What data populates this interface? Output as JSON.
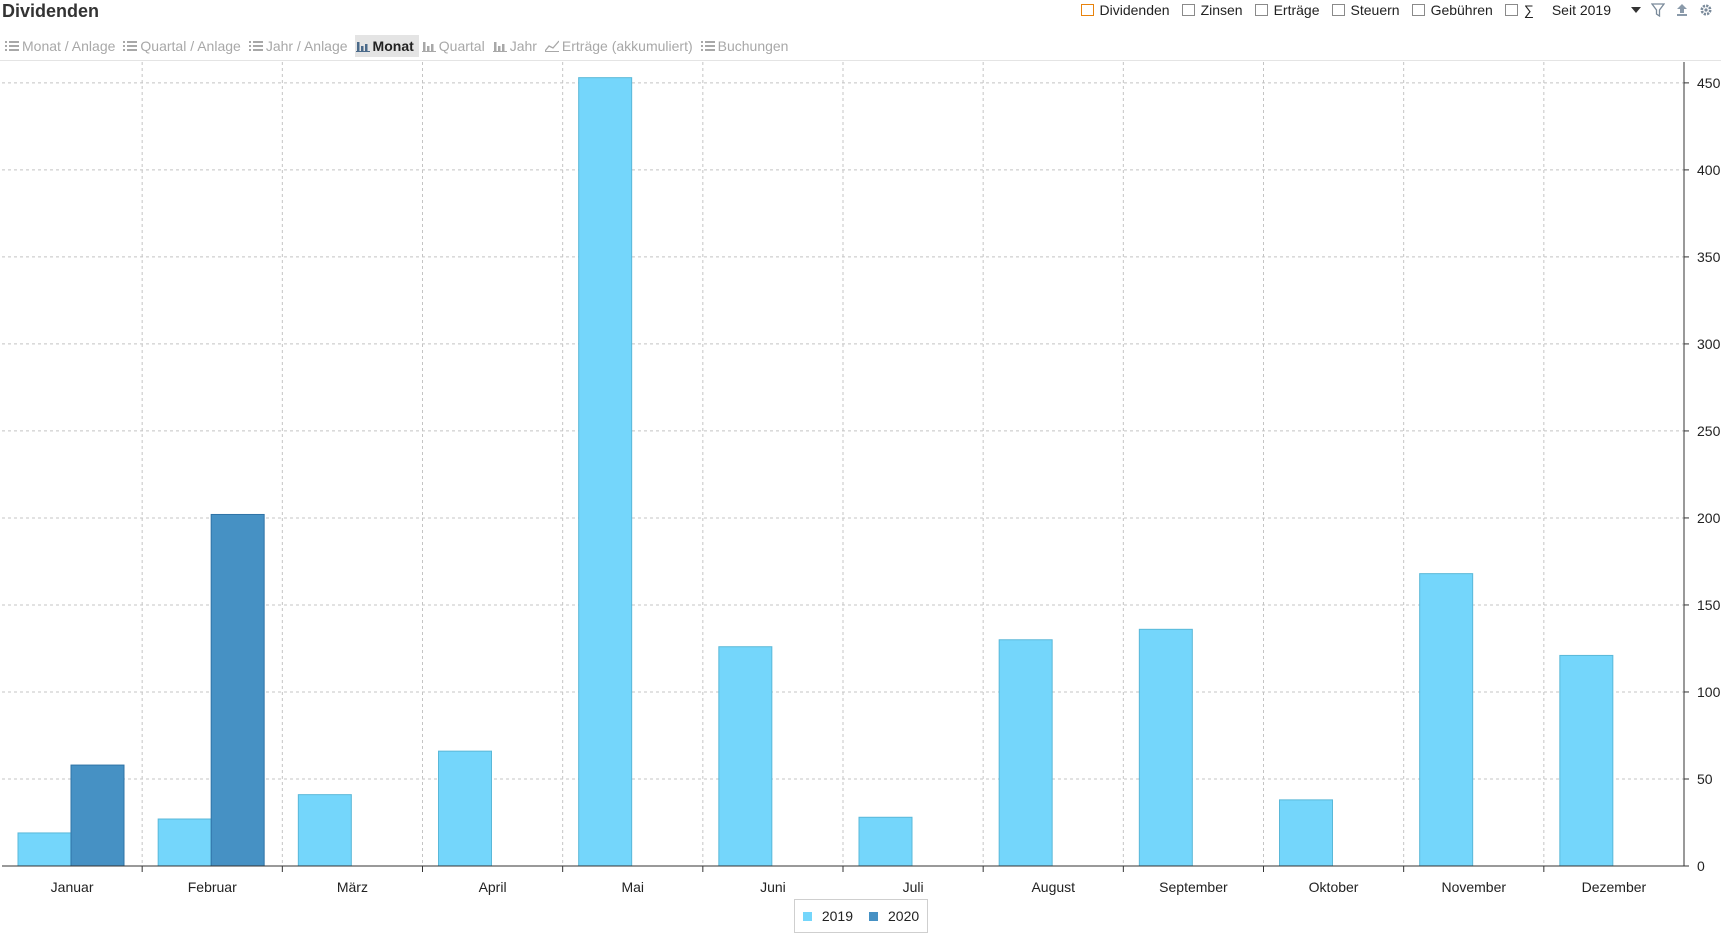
{
  "title": "Dividenden",
  "filters": [
    {
      "label": "Dividenden",
      "checked": true
    },
    {
      "label": "Zinsen",
      "checked": false
    },
    {
      "label": "Erträge",
      "checked": false
    },
    {
      "label": "Steuern",
      "checked": false
    },
    {
      "label": "Gebühren",
      "checked": false
    },
    {
      "label": "∑",
      "checked": false
    }
  ],
  "period": "Seit 2019",
  "tabs": [
    {
      "label": "Monat / Anlage",
      "icon": "list-icon",
      "active": false
    },
    {
      "label": "Quartal / Anlage",
      "icon": "list-icon",
      "active": false
    },
    {
      "label": "Jahr / Anlage",
      "icon": "list-icon",
      "active": false
    },
    {
      "label": "Monat",
      "icon": "bar-chart-icon",
      "active": true
    },
    {
      "label": "Quartal",
      "icon": "bar-chart-icon",
      "active": false
    },
    {
      "label": "Jahr",
      "icon": "bar-chart-icon",
      "active": false
    },
    {
      "label": "Erträge (akkumuliert)",
      "icon": "line-chart-icon",
      "active": false
    },
    {
      "label": "Buchungen",
      "icon": "list-icon",
      "active": false
    }
  ],
  "colors": {
    "series_2019": "#74d6fb",
    "series_2020": "#4691c4",
    "accent": "#e8830d"
  },
  "chart_data": {
    "type": "bar",
    "categories": [
      "Januar",
      "Februar",
      "März",
      "April",
      "Mai",
      "Juni",
      "Juli",
      "August",
      "September",
      "Oktober",
      "November",
      "Dezember"
    ],
    "series": [
      {
        "name": "2019",
        "values": [
          19,
          27,
          41,
          66,
          453,
          126,
          28,
          130,
          136,
          38,
          168,
          121
        ]
      },
      {
        "name": "2020",
        "values": [
          58,
          202,
          0,
          0,
          0,
          0,
          0,
          0,
          0,
          0,
          0,
          0
        ]
      }
    ],
    "y_ticks": [
      0,
      50,
      100,
      150,
      200,
      250,
      300,
      350,
      400,
      450
    ],
    "ylim": [
      0,
      455
    ],
    "y_axis_side": "right",
    "grid": true,
    "legend": "bottom-center"
  }
}
